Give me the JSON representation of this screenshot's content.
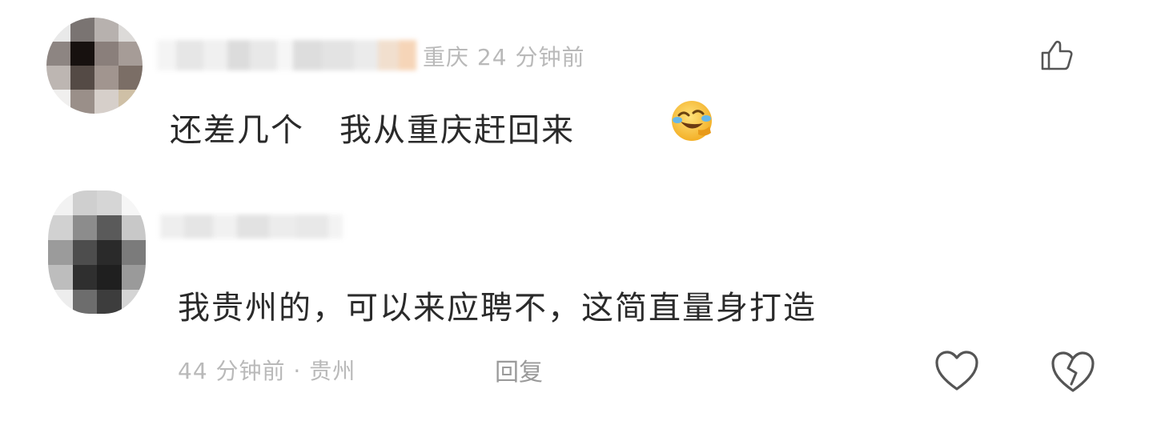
{
  "comments": [
    {
      "location": "重庆",
      "time": "24 分钟前",
      "content_part1": "还差几个",
      "content_part2": "我从重庆赶回来",
      "emoji": "laughing-crying-face-icon",
      "like_icon": "thumbs-up-icon"
    },
    {
      "meta": "44 分钟前 · 贵州",
      "content": "我贵州的，可以来应聘不，这简直量身打造",
      "reply_label": "回复",
      "like_icon": "heart-icon",
      "dislike_icon": "broken-heart-icon"
    }
  ],
  "colors": {
    "text": "#2a2a2a",
    "meta": "#b9b9b9",
    "icon_stroke": "#555555"
  }
}
